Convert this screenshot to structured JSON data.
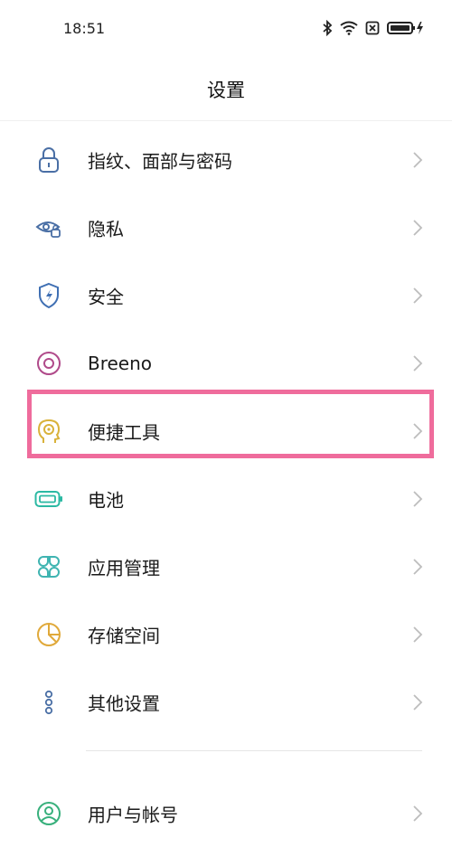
{
  "status_bar": {
    "time": "18:51",
    "icons": [
      "bluetooth-icon",
      "wifi-icon",
      "sim-disabled-icon",
      "battery-charging-icon"
    ]
  },
  "header": {
    "title": "设置"
  },
  "accent_colors": {
    "highlight": "#ef6c9c",
    "lock": "#4a6fa5",
    "privacy": "#4a6fa5",
    "security": "#3f6fb3",
    "breeno": "#b04a8a",
    "shortcut": "#d9b23a",
    "battery": "#2bb9a3",
    "apps": "#3fb4b1",
    "storage": "#e0a93a",
    "other": "#4a6fa5",
    "account": "#38b07c"
  },
  "settings": {
    "items": [
      {
        "label": "指纹、面部与密码",
        "icon": "lock-icon"
      },
      {
        "label": "隐私",
        "icon": "eye-lock-icon"
      },
      {
        "label": "安全",
        "icon": "shield-bolt-icon"
      },
      {
        "label": "Breeno",
        "icon": "breeno-icon"
      },
      {
        "label": "便捷工具",
        "icon": "head-target-icon",
        "highlighted": true
      },
      {
        "label": "电池",
        "icon": "battery-icon"
      },
      {
        "label": "应用管理",
        "icon": "apps-grid-icon"
      },
      {
        "label": "存储空间",
        "icon": "pie-storage-icon"
      },
      {
        "label": "其他设置",
        "icon": "dots-vertical-icon"
      },
      {
        "label": "用户与帐号",
        "icon": "user-account-icon"
      }
    ]
  }
}
